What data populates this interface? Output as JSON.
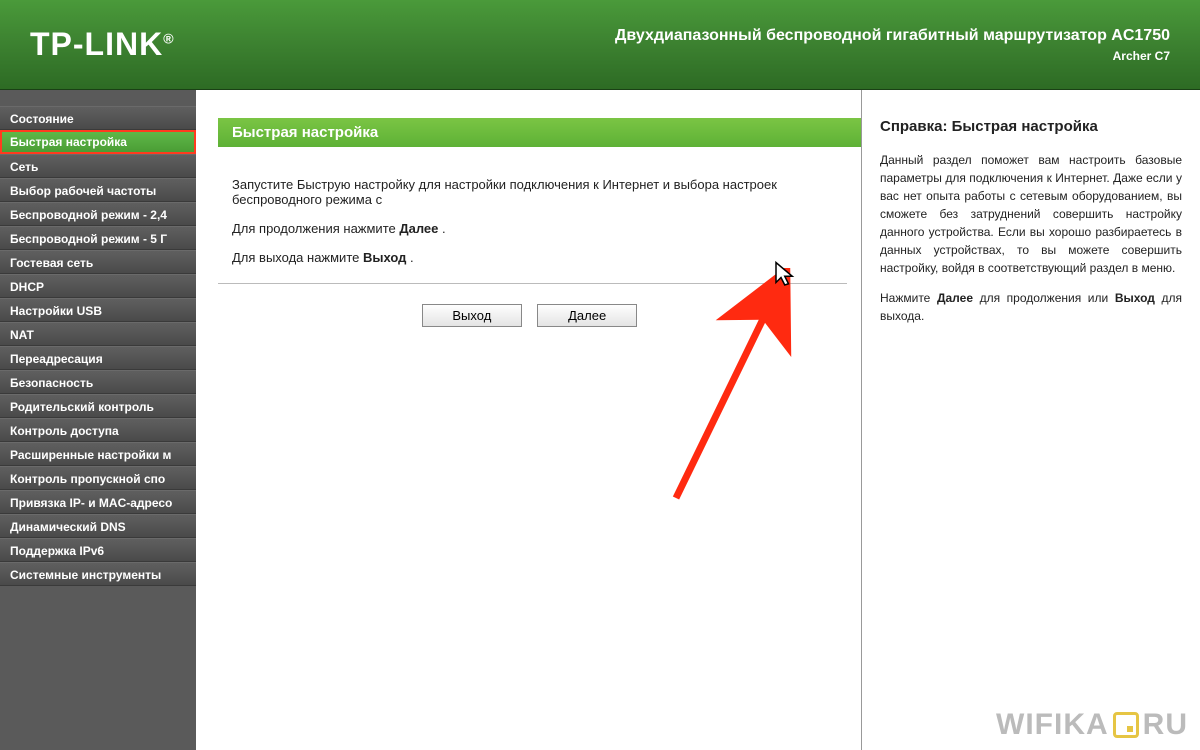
{
  "header": {
    "logo": "TP-LINK",
    "product_title": "Двухдиапазонный беспроводной гигабитный маршрутизатор AC1750",
    "product_model": "Archer C7"
  },
  "sidebar": {
    "items": [
      {
        "label": "Состояние",
        "active": false
      },
      {
        "label": "Быстрая настройка",
        "active": true
      },
      {
        "label": "Сеть",
        "active": false
      },
      {
        "label": "Выбор рабочей частоты",
        "active": false
      },
      {
        "label": "Беспроводной режим - 2,4",
        "active": false
      },
      {
        "label": "Беспроводной режим - 5 Г",
        "active": false
      },
      {
        "label": "Гостевая сеть",
        "active": false
      },
      {
        "label": "DHCP",
        "active": false
      },
      {
        "label": "Настройки USB",
        "active": false
      },
      {
        "label": "NAT",
        "active": false
      },
      {
        "label": "Переадресация",
        "active": false
      },
      {
        "label": "Безопасность",
        "active": false
      },
      {
        "label": "Родительский контроль",
        "active": false
      },
      {
        "label": "Контроль доступа",
        "active": false
      },
      {
        "label": "Расширенные настройки м",
        "active": false
      },
      {
        "label": "Контроль пропускной спо",
        "active": false
      },
      {
        "label": "Привязка IP- и MAC-адресо",
        "active": false
      },
      {
        "label": "Динамический DNS",
        "active": false
      },
      {
        "label": "Поддержка IPv6",
        "active": false
      },
      {
        "label": "Системные инструменты",
        "active": false
      }
    ]
  },
  "main": {
    "heading": "Быстрая настройка",
    "intro": "Запустите Быструю настройку для настройки подключения к Интернет и выбора настроек беспроводного режима с",
    "line2_a": "Для продолжения нажмите ",
    "line2_b": "Далее",
    "line2_c": " .",
    "line3_a": "Для выхода нажмите ",
    "line3_b": "Выход",
    "line3_c": " .",
    "btn_exit": "Выход",
    "btn_next": "Далее"
  },
  "help": {
    "title": "Справка: Быстрая настройка",
    "p1": "Данный раздел поможет вам настроить базовые параметры для подключения к Интернет. Даже если у вас нет опыта работы с сетевым оборудованием, вы сможете без затруднений совершить настройку данного устройства. Если вы хорошо разбираетесь в данных устройствах, то вы можете совершить настройку, войдя в соответствующий раздел в меню.",
    "p2_a": "Нажмите ",
    "p2_b": "Далее",
    "p2_c": " для продолжения или ",
    "p2_d": "Выход",
    "p2_e": " для выхода."
  },
  "watermark": {
    "part1": "WIFIKA",
    "part2": "RU"
  }
}
